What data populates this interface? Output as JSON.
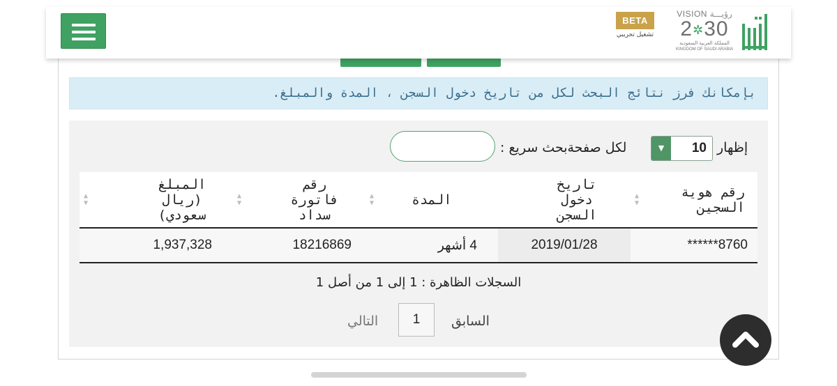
{
  "header": {
    "beta_label": "BETA",
    "beta_sub": "تشغيل تجريبي",
    "vision_word": "VISION",
    "vision_ar": "رؤيـــة",
    "vision_year_left": "2",
    "vision_year_right": "30",
    "vision_kingdom_ar": "المملكة العربية السعودية",
    "vision_kingdom_en": "KINGDOM OF SAUDI ARABIA",
    "brand_color": "#3fa262"
  },
  "notice": {
    "text": "بإمكانك فرز نتائج البحث لكل من تاريخ دخول السجن ، المدة والمبلغ."
  },
  "controls": {
    "show_label": "إظهار",
    "page_size": "10",
    "per_page_label": "لكل صفحةبحث سريع :",
    "search_value": ""
  },
  "table": {
    "columns": [
      "رقم هوية السجين",
      "تاريخ دخول السجن",
      "المدة",
      "رقم فاتورة سداد",
      "المبلغ (ريال سعودي)"
    ],
    "rows": [
      {
        "prisoner_id": "******8760",
        "entry_date": "2019/01/28",
        "duration": "4 أشهر",
        "invoice": "18216869",
        "amount": "1,937,328"
      }
    ]
  },
  "footer": {
    "records_text": "السجلات الظاهرة : 1 إلى 1 من أصل 1",
    "prev_label": "السابق",
    "current_page": "1",
    "next_label": "التالي"
  }
}
